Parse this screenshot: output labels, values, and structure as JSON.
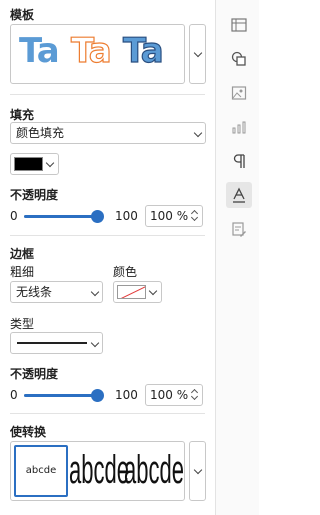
{
  "template": {
    "header": "模板",
    "samples": [
      "Ta",
      "Ta",
      "Ta"
    ]
  },
  "fill": {
    "header": "填充",
    "type_value": "颜色填充",
    "color": "#000000"
  },
  "opacity1": {
    "header": "不透明度",
    "min": "0",
    "max": "100",
    "value_text": "100 %",
    "value": 1.0
  },
  "border": {
    "header": "边框",
    "weight_label": "粗细",
    "weight_value": "无线条",
    "color_label": "颜色",
    "type_label": "类型"
  },
  "opacity2": {
    "header": "不透明度",
    "min": "0",
    "max": "100",
    "value_text": "100 %",
    "value": 1.0
  },
  "transform": {
    "header": "使转换",
    "samples": [
      "abcde",
      "abcde",
      "abcde"
    ]
  },
  "right_bar": {
    "icons": [
      "table-icon",
      "shape-icon",
      "image-icon",
      "chart-icon",
      "paragraph-icon",
      "text-art-icon",
      "signature-icon"
    ],
    "active": "text-art-icon"
  },
  "colors": {
    "accent": "#2b6fc2",
    "ta_blue": "#5b9bd5",
    "ta_orange": "#ed7d31",
    "ta_navy": "#4a7ab5"
  }
}
